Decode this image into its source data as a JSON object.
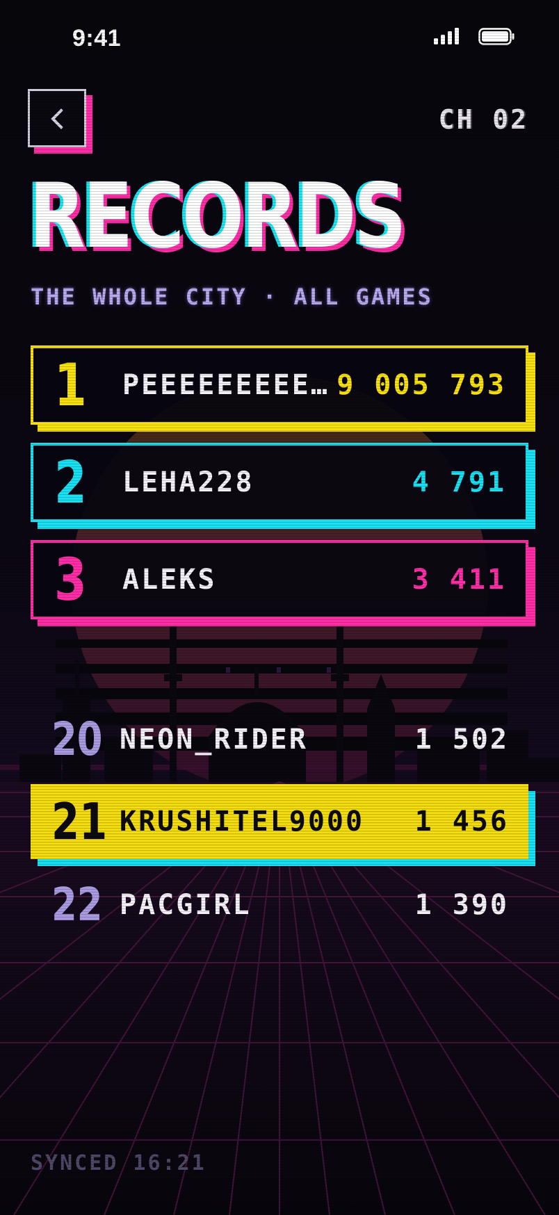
{
  "status_bar": {
    "time": "9:41"
  },
  "header": {
    "back_icon": "chevron-left-icon",
    "channel": "CH 02",
    "title": "RECORDS",
    "subtitle": "THE WHOLE CITY · ALL GAMES"
  },
  "colors": {
    "gold": "#f7e00e",
    "cyan": "#19dff0",
    "magenta": "#ff2ea6",
    "lavender": "#a99ae0",
    "background": "#07050d"
  },
  "leaderboard": {
    "podium": [
      {
        "rank": "1",
        "player": "PEEEEEEEEE…",
        "score": "9 005 793"
      },
      {
        "rank": "2",
        "player": "LEHA228",
        "score": "4 791"
      },
      {
        "rank": "3",
        "player": "ALEKS",
        "score": "3 411"
      }
    ],
    "nearby": [
      {
        "rank": "20",
        "player": "NEON_RIDER",
        "score": "1 502"
      },
      {
        "rank": "21",
        "player": "KRUSHITEL9000",
        "score": "1 456",
        "current_user": true
      },
      {
        "rank": "22",
        "player": "PACGIRL",
        "score": "1 390"
      }
    ]
  },
  "footer": {
    "synced": "SYNCED 16:21"
  }
}
